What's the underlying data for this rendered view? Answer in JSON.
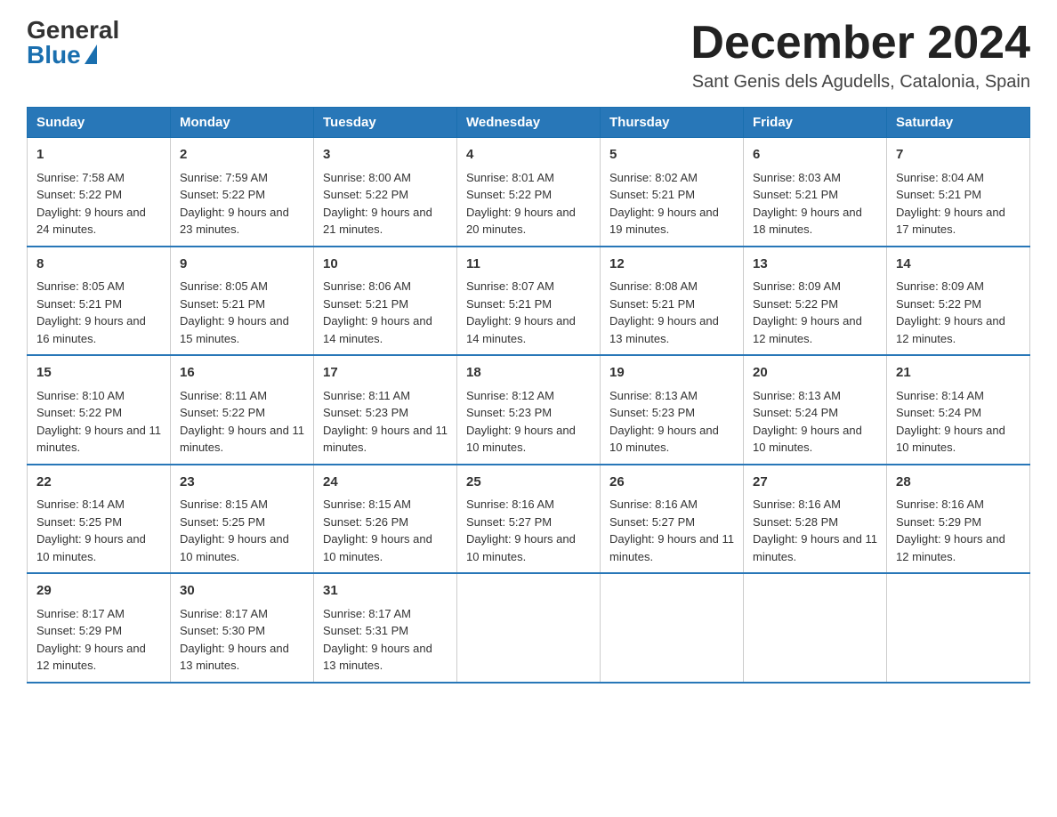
{
  "header": {
    "logo_general": "General",
    "logo_blue": "Blue",
    "month_title": "December 2024",
    "location": "Sant Genis dels Agudells, Catalonia, Spain"
  },
  "weekdays": [
    "Sunday",
    "Monday",
    "Tuesday",
    "Wednesday",
    "Thursday",
    "Friday",
    "Saturday"
  ],
  "weeks": [
    [
      {
        "day": "1",
        "sunrise": "7:58 AM",
        "sunset": "5:22 PM",
        "daylight": "9 hours and 24 minutes."
      },
      {
        "day": "2",
        "sunrise": "7:59 AM",
        "sunset": "5:22 PM",
        "daylight": "9 hours and 23 minutes."
      },
      {
        "day": "3",
        "sunrise": "8:00 AM",
        "sunset": "5:22 PM",
        "daylight": "9 hours and 21 minutes."
      },
      {
        "day": "4",
        "sunrise": "8:01 AM",
        "sunset": "5:22 PM",
        "daylight": "9 hours and 20 minutes."
      },
      {
        "day": "5",
        "sunrise": "8:02 AM",
        "sunset": "5:21 PM",
        "daylight": "9 hours and 19 minutes."
      },
      {
        "day": "6",
        "sunrise": "8:03 AM",
        "sunset": "5:21 PM",
        "daylight": "9 hours and 18 minutes."
      },
      {
        "day": "7",
        "sunrise": "8:04 AM",
        "sunset": "5:21 PM",
        "daylight": "9 hours and 17 minutes."
      }
    ],
    [
      {
        "day": "8",
        "sunrise": "8:05 AM",
        "sunset": "5:21 PM",
        "daylight": "9 hours and 16 minutes."
      },
      {
        "day": "9",
        "sunrise": "8:05 AM",
        "sunset": "5:21 PM",
        "daylight": "9 hours and 15 minutes."
      },
      {
        "day": "10",
        "sunrise": "8:06 AM",
        "sunset": "5:21 PM",
        "daylight": "9 hours and 14 minutes."
      },
      {
        "day": "11",
        "sunrise": "8:07 AM",
        "sunset": "5:21 PM",
        "daylight": "9 hours and 14 minutes."
      },
      {
        "day": "12",
        "sunrise": "8:08 AM",
        "sunset": "5:21 PM",
        "daylight": "9 hours and 13 minutes."
      },
      {
        "day": "13",
        "sunrise": "8:09 AM",
        "sunset": "5:22 PM",
        "daylight": "9 hours and 12 minutes."
      },
      {
        "day": "14",
        "sunrise": "8:09 AM",
        "sunset": "5:22 PM",
        "daylight": "9 hours and 12 minutes."
      }
    ],
    [
      {
        "day": "15",
        "sunrise": "8:10 AM",
        "sunset": "5:22 PM",
        "daylight": "9 hours and 11 minutes."
      },
      {
        "day": "16",
        "sunrise": "8:11 AM",
        "sunset": "5:22 PM",
        "daylight": "9 hours and 11 minutes."
      },
      {
        "day": "17",
        "sunrise": "8:11 AM",
        "sunset": "5:23 PM",
        "daylight": "9 hours and 11 minutes."
      },
      {
        "day": "18",
        "sunrise": "8:12 AM",
        "sunset": "5:23 PM",
        "daylight": "9 hours and 10 minutes."
      },
      {
        "day": "19",
        "sunrise": "8:13 AM",
        "sunset": "5:23 PM",
        "daylight": "9 hours and 10 minutes."
      },
      {
        "day": "20",
        "sunrise": "8:13 AM",
        "sunset": "5:24 PM",
        "daylight": "9 hours and 10 minutes."
      },
      {
        "day": "21",
        "sunrise": "8:14 AM",
        "sunset": "5:24 PM",
        "daylight": "9 hours and 10 minutes."
      }
    ],
    [
      {
        "day": "22",
        "sunrise": "8:14 AM",
        "sunset": "5:25 PM",
        "daylight": "9 hours and 10 minutes."
      },
      {
        "day": "23",
        "sunrise": "8:15 AM",
        "sunset": "5:25 PM",
        "daylight": "9 hours and 10 minutes."
      },
      {
        "day": "24",
        "sunrise": "8:15 AM",
        "sunset": "5:26 PM",
        "daylight": "9 hours and 10 minutes."
      },
      {
        "day": "25",
        "sunrise": "8:16 AM",
        "sunset": "5:27 PM",
        "daylight": "9 hours and 10 minutes."
      },
      {
        "day": "26",
        "sunrise": "8:16 AM",
        "sunset": "5:27 PM",
        "daylight": "9 hours and 11 minutes."
      },
      {
        "day": "27",
        "sunrise": "8:16 AM",
        "sunset": "5:28 PM",
        "daylight": "9 hours and 11 minutes."
      },
      {
        "day": "28",
        "sunrise": "8:16 AM",
        "sunset": "5:29 PM",
        "daylight": "9 hours and 12 minutes."
      }
    ],
    [
      {
        "day": "29",
        "sunrise": "8:17 AM",
        "sunset": "5:29 PM",
        "daylight": "9 hours and 12 minutes."
      },
      {
        "day": "30",
        "sunrise": "8:17 AM",
        "sunset": "5:30 PM",
        "daylight": "9 hours and 13 minutes."
      },
      {
        "day": "31",
        "sunrise": "8:17 AM",
        "sunset": "5:31 PM",
        "daylight": "9 hours and 13 minutes."
      },
      null,
      null,
      null,
      null
    ]
  ],
  "labels": {
    "sunrise": "Sunrise: ",
    "sunset": "Sunset: ",
    "daylight": "Daylight: "
  }
}
